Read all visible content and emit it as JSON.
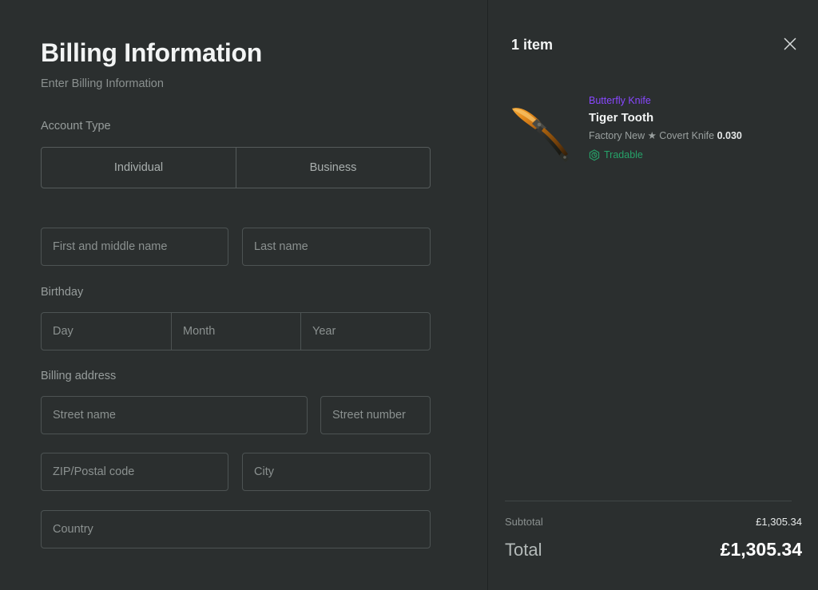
{
  "billing": {
    "title": "Billing Information",
    "subtitle": "Enter Billing Information",
    "account_type": {
      "label": "Account Type",
      "options": [
        "Individual",
        "Business"
      ]
    },
    "name_fields": {
      "first_name_placeholder": "First and middle name",
      "last_name_placeholder": "Last name"
    },
    "birthday": {
      "label": "Birthday",
      "day_placeholder": "Day",
      "month_placeholder": "Month",
      "year_placeholder": "Year"
    },
    "address": {
      "label": "Billing address",
      "street_name_placeholder": "Street name",
      "street_number_placeholder": "Street number",
      "zip_placeholder": "ZIP/Postal code",
      "city_placeholder": "City",
      "country_placeholder": "Country"
    }
  },
  "cart": {
    "count_label": "1 item",
    "close_icon": "close-icon",
    "items": [
      {
        "category": "Butterfly Knife",
        "name": "Tiger Tooth",
        "condition": "Factory New",
        "separator": "★",
        "type": "Covert Knife",
        "float": "0.030",
        "meta_line": "Factory New ★ Covert Knife",
        "badge_label": "Tradable",
        "badge_icon": "clock-hexagon-icon",
        "thumbnail_icon": "butterfly-knife-icon"
      }
    ],
    "totals": {
      "subtotal_label": "Subtotal",
      "subtotal_value": "£1,305.34",
      "total_label": "Total",
      "total_value": "£1,305.34"
    }
  },
  "colors": {
    "background": "#2b2f2f",
    "rarity_purple": "#8847ff",
    "tradable_green": "#26a269",
    "field_border": "#4d5353",
    "scrollbar_thumb": "#4b5553"
  }
}
